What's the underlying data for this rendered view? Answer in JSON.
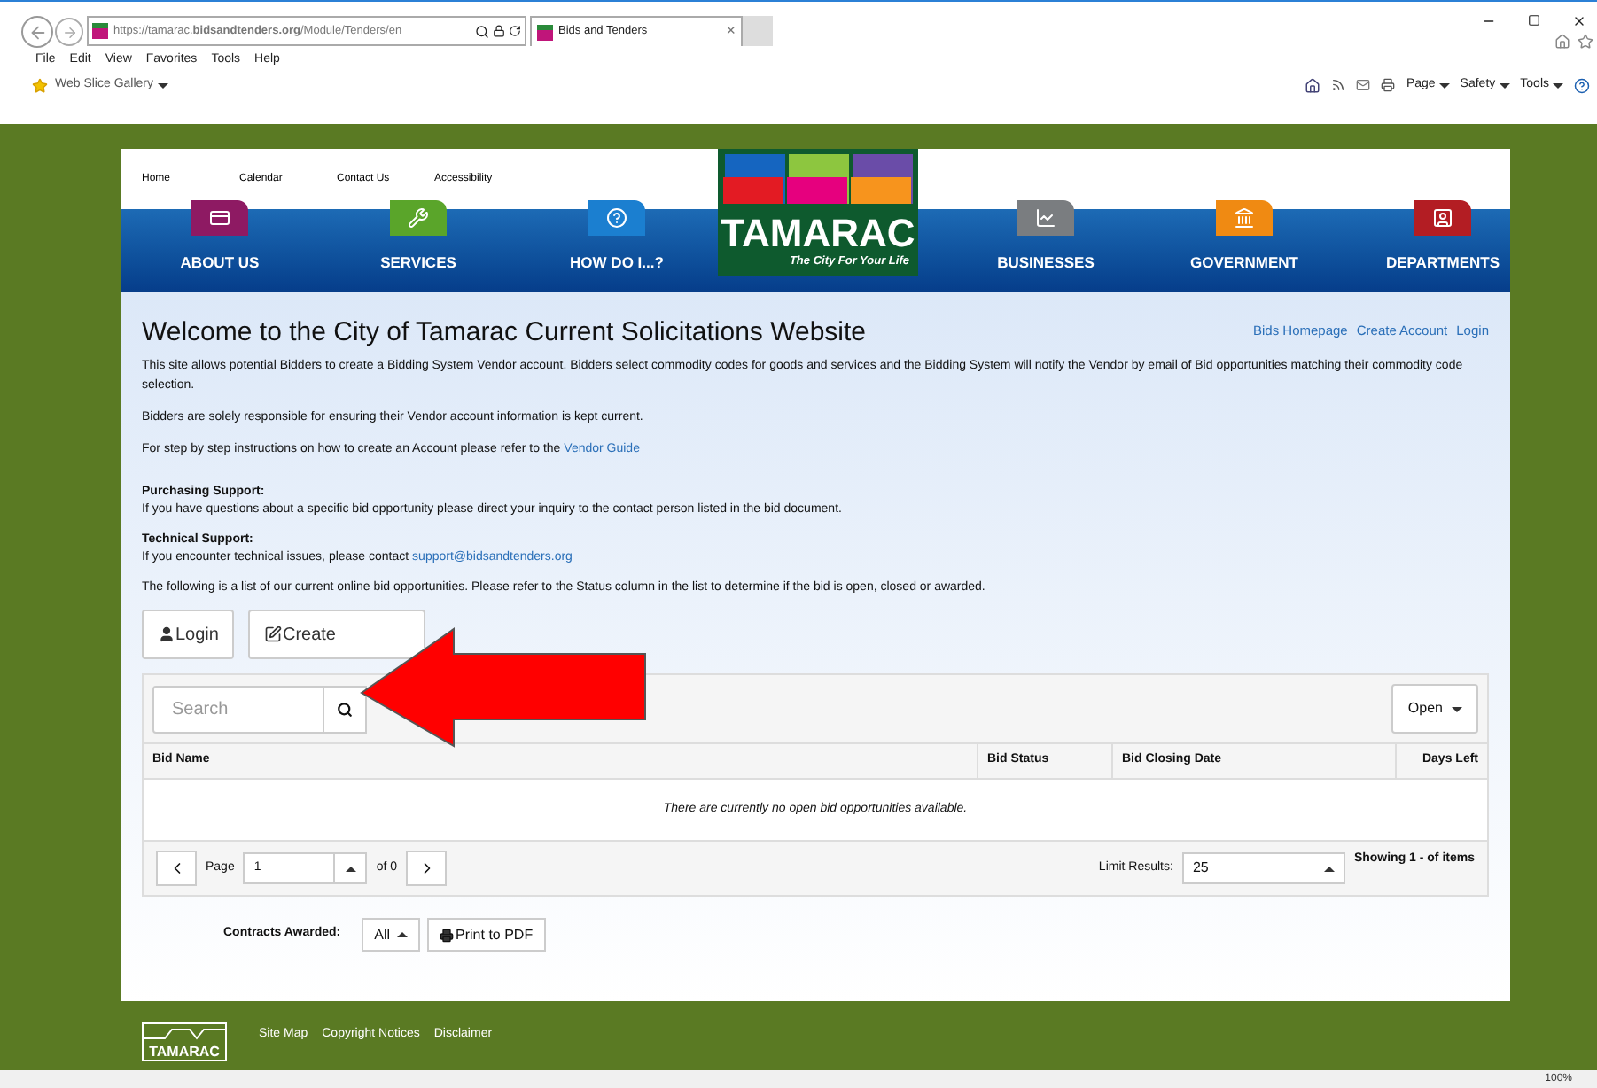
{
  "browser": {
    "address": "https://tamarac.**bidsandtenders.org**/Module/Tenders/en",
    "tab": {
      "title": "Bids and Tenders",
      "close": "×"
    },
    "menu": [
      "File",
      "Edit",
      "View",
      "Favorites",
      "Tools",
      "Help"
    ],
    "favorites": [
      "Web Slice Gallery"
    ],
    "toolbar": [
      "Page",
      "Safety",
      "Tools"
    ],
    "zoom": "100%"
  },
  "site": {
    "top_links": [
      "Home",
      "Calendar",
      "Contact Us",
      "Accessibility"
    ],
    "nav": [
      {
        "label": "ABOUT US",
        "color": "#8e1a63"
      },
      {
        "label": "SERVICES",
        "color": "#5aa52a"
      },
      {
        "label": "HOW DO I...?",
        "color": "#1b7fd0"
      },
      {
        "label": "BUSINESSES",
        "color": "#7a7d80"
      },
      {
        "label": "GOVERNMENT",
        "color": "#f08a12"
      },
      {
        "label": "DEPARTMENTS",
        "color": "#b31d23"
      }
    ],
    "logo": {
      "name": "TAMARAC",
      "tagline": "The City For Your Life"
    }
  },
  "content": {
    "title": "Welcome to the City of Tamarac Current Solicitations Website",
    "links": [
      "Bids Homepage",
      "Create Account",
      "Login"
    ],
    "paragraphs": [
      {
        "text": "This site allows potential Bidders to create a Bidding System Vendor account.  Bidders select commodity codes for goods and services and the Bidding System will notify the Vendor by email of Bid opportunities matching their commodity code selection."
      },
      {
        "text": "Bidders are solely responsible for ensuring their Vendor account information is kept current."
      },
      {
        "text": "For step by step instructions on how to create an Account please refer to the",
        "link": "Vendor Guide"
      }
    ],
    "sections": [
      {
        "heading": "Purchasing Support:",
        "text": "If you have questions about a specific bid opportunity please direct your inquiry to the contact person listed in the bid document."
      },
      {
        "heading": "Technical Support:",
        "text": "If you encounter technical issues, please contact",
        "link": "support@bidsandtenders.org"
      }
    ],
    "list_intro": "The following is a list of our current online bid opportunities. Please refer to the Status column in the list to determine if the bid is open, closed or awarded.",
    "buttons": [
      {
        "label": "Login",
        "kind": "user"
      },
      {
        "label": "Create",
        "kind": "edit"
      }
    ],
    "search": {
      "placeholder": "Search"
    },
    "filter": "Open",
    "table": {
      "columns": [
        "Bid Name",
        "Bid Status",
        "Bid Closing Date",
        "Days Left"
      ],
      "empty": "There are currently no open bid opportunities available."
    },
    "pager": {
      "page_label": "Page",
      "page": "1",
      "of": "of 0",
      "limit_label": "Limit Results:",
      "limit": "25",
      "showing": "Showing 1 - of items"
    },
    "contracts": {
      "label": "Contracts Awarded:",
      "value": "All",
      "print": "Print to PDF"
    }
  },
  "footer": {
    "logo": "TAMARAC",
    "links": [
      "Site Map",
      "Copyright Notices",
      "Disclaimer"
    ]
  }
}
